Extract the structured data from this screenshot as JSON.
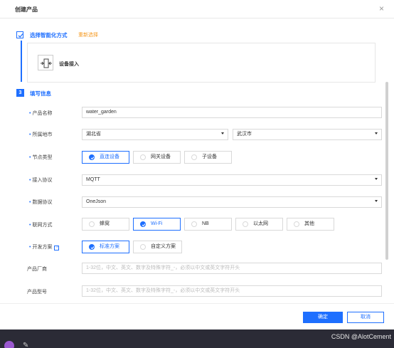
{
  "dialog": {
    "title": "创建产品",
    "close_glyph": "×"
  },
  "step1": {
    "title": "选择智能化方式",
    "reselect": "重新选择",
    "access_label": "设备接入"
  },
  "step3": {
    "number": "3",
    "title": "填写信息"
  },
  "form": {
    "product_name": {
      "label": "产品名称",
      "value": "water_garden"
    },
    "region": {
      "label": "所属地市",
      "province": "湖北省",
      "city": "武汉市"
    },
    "node_type": {
      "label": "节点类型",
      "options": [
        "直连设备",
        "网关设备",
        "子设备"
      ],
      "selected": "直连设备"
    },
    "access_protocol": {
      "label": "接入协议",
      "value": "MQTT"
    },
    "data_protocol": {
      "label": "数据协议",
      "value": "OneJson"
    },
    "network": {
      "label": "联网方式",
      "options": [
        "蜂窝",
        "Wi-Fi",
        "NB",
        "以太网",
        "其他"
      ],
      "selected": "Wi-Fi"
    },
    "dev_plan": {
      "label": "开发方案",
      "help": "?",
      "options": [
        "标准方案",
        "自定义方案"
      ],
      "selected": "标准方案"
    },
    "manufacturer": {
      "label": "产品厂商",
      "placeholder": "1-32位，中文、英文、数字及特殊字符_-，必须以中文或英文字符开头"
    },
    "model": {
      "label": "产品型号",
      "placeholder": "1-32位，中文、英文、数字及特殊字符_-，必须以中文或英文字符开头"
    }
  },
  "footer": {
    "ok": "确定",
    "cancel": "取消"
  },
  "taskbar": {
    "watermark": "CSDN @AlotCement"
  },
  "colors": {
    "accent": "#1e6fff",
    "reselect": "#f59a23"
  }
}
